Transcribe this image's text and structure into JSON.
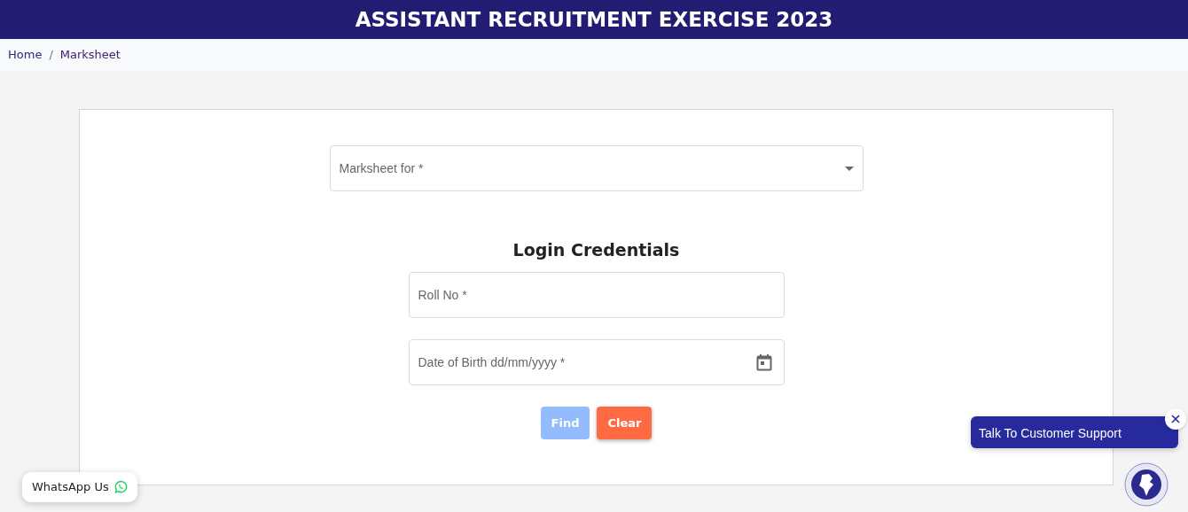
{
  "header": {
    "title": "ASSISTANT RECRUITMENT EXERCISE 2023"
  },
  "breadcrumb_separator": "/",
  "breadcrumb": [
    {
      "label": "Home",
      "selected": false
    },
    {
      "label": "Marksheet",
      "selected": true
    }
  ],
  "form": {
    "select": {
      "placeholder": "Marksheet for *"
    },
    "heading": "Login Credentials",
    "fields": [
      {
        "kind": "text",
        "placeholder": "Roll No *"
      },
      {
        "kind": "date",
        "placeholder": "Date of Birth dd/mm/yyyy *"
      }
    ],
    "buttons": [
      {
        "label": "Find",
        "kind": "primary",
        "disabled": true
      },
      {
        "label": "Clear",
        "kind": "danger",
        "disabled": false
      }
    ]
  },
  "whatsapp": {
    "label": "WhatsApp Us"
  },
  "support": {
    "label": "Talk To Customer Support"
  }
}
